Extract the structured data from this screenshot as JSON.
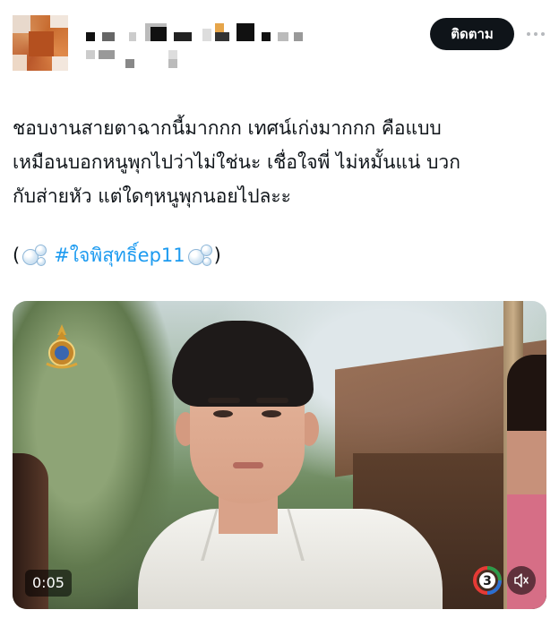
{
  "post": {
    "follow_label": "ติดตาม",
    "text_lines": [
      "ชอบงานสายตาฉากนี้มากกก เทศน์เก่งมากกก คือแบบ",
      "เหมือนบอกหนูพุกไปว่าไม่ใช่นะ เชื่อใจพี่ ไม่หมั้นแน่ บวก",
      "กับส่ายหัว แต่ใดๆหนูพุกนอยไปละะ"
    ],
    "hashtag_prefix": "(",
    "hashtag": "#ใจพิสุทธิ์ep11",
    "hashtag_suffix": ")"
  },
  "media": {
    "video_time": "0:05",
    "channel_logo": "ch3-logo"
  },
  "icons": {
    "more": "more-icon",
    "mute": "speaker-muted-icon",
    "bubble": "bubbles-emoji-icon"
  },
  "colors": {
    "follow_button_bg": "#0f1419",
    "hashtag": "#1d9bf0",
    "text": "#0f1419"
  }
}
